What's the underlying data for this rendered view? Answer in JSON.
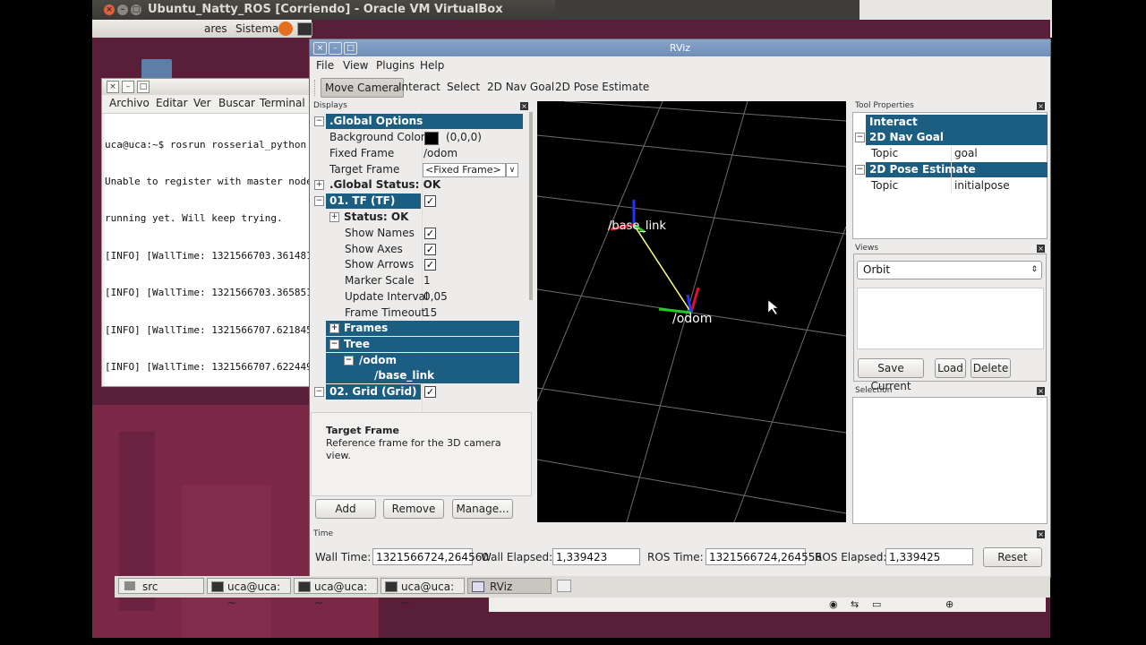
{
  "vbox": {
    "title": "Ubuntu_Natty_ROS [Corriendo] - Oracle VM VirtualBox"
  },
  "guest_panel": {
    "item1": "ares",
    "item2": "Sistema"
  },
  "terminal": {
    "menu": [
      "Archivo",
      "Editar",
      "Ver",
      "Buscar",
      "Terminal"
    ],
    "lines": [
      "uca@uca:~$ rosrun rosserial_python",
      "Unable to register with master node",
      "running yet. Will keep trying.",
      "[INFO] [WallTime: 1321566703.361481",
      "[INFO] [WallTime: 1321566703.365851",
      "[INFO] [WallTime: 1321566707.621845",
      "[INFO] [WallTime: 1321566707.622449"
    ]
  },
  "rviz": {
    "title": "RViz",
    "menu": [
      "File",
      "View",
      "Plugins",
      "Help"
    ],
    "tools": [
      "Move Camera",
      "Interact",
      "Select",
      "2D Nav Goal",
      "2D Pose Estimate"
    ],
    "displays": {
      "panel_title": "Displays",
      "global_options": ".Global Options",
      "background_color_label": "Background Color",
      "background_color_value": "(0,0,0)",
      "fixed_frame_label": "Fixed Frame",
      "fixed_frame_value": "/odom",
      "target_frame_label": "Target Frame",
      "target_frame_value": "<Fixed Frame>",
      "global_status": ".Global Status: OK",
      "tf_label": "01. TF (TF)",
      "status_ok": "Status: OK",
      "show_names": "Show Names",
      "show_axes": "Show Axes",
      "show_arrows": "Show Arrows",
      "marker_scale_label": "Marker Scale",
      "marker_scale_value": "1",
      "update_interval_label": "Update Interval",
      "update_interval_value": "0,05",
      "frame_timeout_label": "Frame Timeout",
      "frame_timeout_value": "15",
      "frames": "Frames",
      "tree": "Tree",
      "odom": "/odom",
      "base_link": "/base_link",
      "grid_label": "02. Grid (Grid)",
      "desc_title": "Target Frame",
      "desc_text": "Reference frame for the 3D camera view.",
      "add": "Add",
      "remove": "Remove",
      "manage": "Manage..."
    },
    "view3d": {
      "label_base": "/base_link",
      "label_odom": "/odom"
    },
    "tool_properties": {
      "title": "Tool Properties",
      "interact": "Interact",
      "nav_goal": "2D Nav Goal",
      "topic_label": "Topic",
      "nav_goal_topic": "goal",
      "pose_estimate": "2D Pose Estimate",
      "pose_topic": "initialpose"
    },
    "views": {
      "title": "Views",
      "selected": "Orbit",
      "save_current": "Save Current",
      "load": "Load",
      "delete": "Delete"
    },
    "selection": {
      "title": "Selection"
    },
    "time": {
      "title": "Time",
      "wall_time_label": "Wall Time:",
      "wall_time": "1321566724,264560",
      "wall_elapsed_label": "Wall Elapsed:",
      "wall_elapsed": "1,339423",
      "ros_time_label": "ROS Time:",
      "ros_time": "1321566724,264556",
      "ros_elapsed_label": "ROS Elapsed:",
      "ros_elapsed": "1,339425",
      "reset": "Reset"
    }
  },
  "taskbar": {
    "items": [
      "src",
      "uca@uca: ~",
      "uca@uca: ~",
      "uca@uca: ~",
      "RViz"
    ]
  },
  "colors": {
    "selection_blue": "#1c5d82",
    "desktop": "#5a1f38",
    "title_blue": "#6f8eb8"
  }
}
